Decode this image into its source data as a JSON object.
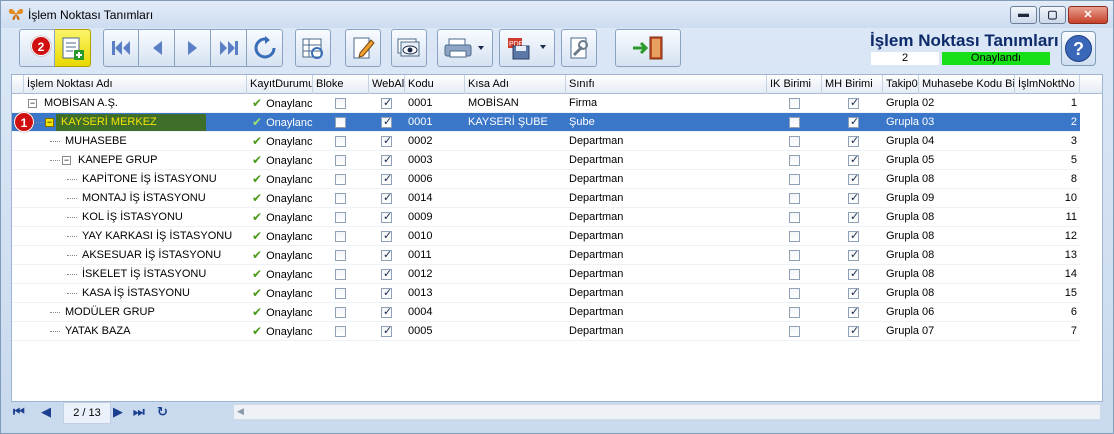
{
  "window": {
    "title": "İşlem Noktası Tanımları",
    "buttons": [
      "min",
      "max",
      "close"
    ]
  },
  "header": {
    "title": "İşlem Noktası Tanımları",
    "record_count": "2",
    "status": "Onaylandı",
    "status_color": "#18e018"
  },
  "badges": {
    "row_marker": "1",
    "add_marker": "2"
  },
  "toolbar": {
    "icons": [
      "circle-icon",
      "add-record-icon",
      "first-icon",
      "prev-icon",
      "next-icon",
      "last-icon",
      "refresh-icon",
      "grid-settings-icon",
      "edit-icon",
      "preview-icon",
      "print-icon",
      "pdf-export-icon",
      "tools-icon",
      "exit-icon",
      "help-icon"
    ]
  },
  "columns": [
    "İşlem Noktası Adı",
    "KayıtDurumu",
    "Bloke",
    "WebAl",
    "Kodu",
    "Kısa Adı",
    "Sınıfı",
    "IK Birimi",
    "MH Birimi",
    "Takip0",
    "Muhasebe Kodu Bilo",
    "İşlmNoktNo"
  ],
  "rows": [
    {
      "name": "MOBİSAN A.Ş.",
      "status": "Onaylanc",
      "bloke": false,
      "web": true,
      "kodu": "0001",
      "kisa": "MOBİSAN",
      "sinif": "Firma",
      "ik": false,
      "mh": true,
      "takip": "Grupla",
      "muh": "02",
      "no": "1",
      "level": 0,
      "expander": "−",
      "selected": false
    },
    {
      "name": "KAYSERİ MERKEZ",
      "status": "Onaylanc",
      "bloke": false,
      "web": true,
      "kodu": "0001",
      "kisa": "KAYSERİ ŞUBE",
      "sinif": "Şube",
      "ik": false,
      "mh": true,
      "takip": "Grupla",
      "muh": "03",
      "no": "2",
      "level": 1,
      "expander": "−",
      "selected": true
    },
    {
      "name": "MUHASEBE",
      "status": "Onaylanc",
      "bloke": false,
      "web": true,
      "kodu": "0002",
      "kisa": "",
      "sinif": "Departman",
      "ik": false,
      "mh": true,
      "takip": "Grupla",
      "muh": "04",
      "no": "3",
      "level": 2,
      "expander": "",
      "selected": false
    },
    {
      "name": "KANEPE GRUP",
      "status": "Onaylanc",
      "bloke": false,
      "web": true,
      "kodu": "0003",
      "kisa": "",
      "sinif": "Departman",
      "ik": false,
      "mh": true,
      "takip": "Grupla",
      "muh": "05",
      "no": "5",
      "level": 2,
      "expander": "−",
      "selected": false
    },
    {
      "name": "KAPİTONE İŞ İSTASYONU",
      "status": "Onaylanc",
      "bloke": false,
      "web": true,
      "kodu": "0006",
      "kisa": "",
      "sinif": "Departman",
      "ik": false,
      "mh": true,
      "takip": "Grupla",
      "muh": "08",
      "no": "8",
      "level": 3,
      "expander": "",
      "selected": false
    },
    {
      "name": "MONTAJ İŞ İSTASYONU",
      "status": "Onaylanc",
      "bloke": false,
      "web": true,
      "kodu": "0014",
      "kisa": "",
      "sinif": "Departman",
      "ik": false,
      "mh": true,
      "takip": "Grupla",
      "muh": "09",
      "no": "10",
      "level": 3,
      "expander": "",
      "selected": false
    },
    {
      "name": "KOL İŞ İSTASYONU",
      "status": "Onaylanc",
      "bloke": false,
      "web": true,
      "kodu": "0009",
      "kisa": "",
      "sinif": "Departman",
      "ik": false,
      "mh": true,
      "takip": "Grupla",
      "muh": "08",
      "no": "11",
      "level": 3,
      "expander": "",
      "selected": false
    },
    {
      "name": "YAY KARKASI İŞ İSTASYONU",
      "status": "Onaylanc",
      "bloke": false,
      "web": true,
      "kodu": "0010",
      "kisa": "",
      "sinif": "Departman",
      "ik": false,
      "mh": true,
      "takip": "Grupla",
      "muh": "08",
      "no": "12",
      "level": 3,
      "expander": "",
      "selected": false
    },
    {
      "name": "AKSESUAR İŞ İSTASYONU",
      "status": "Onaylanc",
      "bloke": false,
      "web": true,
      "kodu": "0011",
      "kisa": "",
      "sinif": "Departman",
      "ik": false,
      "mh": true,
      "takip": "Grupla",
      "muh": "08",
      "no": "13",
      "level": 3,
      "expander": "",
      "selected": false
    },
    {
      "name": "İSKELET İŞ İSTASYONU",
      "status": "Onaylanc",
      "bloke": false,
      "web": true,
      "kodu": "0012",
      "kisa": "",
      "sinif": "Departman",
      "ik": false,
      "mh": true,
      "takip": "Grupla",
      "muh": "08",
      "no": "14",
      "level": 3,
      "expander": "",
      "selected": false
    },
    {
      "name": "KASA İŞ İSTASYONU",
      "status": "Onaylanc",
      "bloke": false,
      "web": true,
      "kodu": "0013",
      "kisa": "",
      "sinif": "Departman",
      "ik": false,
      "mh": true,
      "takip": "Grupla",
      "muh": "08",
      "no": "15",
      "level": 3,
      "expander": "",
      "selected": false
    },
    {
      "name": "MODÜLER GRUP",
      "status": "Onaylanc",
      "bloke": false,
      "web": true,
      "kodu": "0004",
      "kisa": "",
      "sinif": "Departman",
      "ik": false,
      "mh": true,
      "takip": "Grupla",
      "muh": "06",
      "no": "6",
      "level": 2,
      "expander": "",
      "selected": false
    },
    {
      "name": "YATAK BAZA",
      "status": "Onaylanc",
      "bloke": false,
      "web": true,
      "kodu": "0005",
      "kisa": "",
      "sinif": "Departman",
      "ik": false,
      "mh": true,
      "takip": "Grupla",
      "muh": "07",
      "no": "7",
      "level": 2,
      "expander": "",
      "selected": false
    }
  ],
  "footer": {
    "page_indicator": "2 / 13"
  }
}
